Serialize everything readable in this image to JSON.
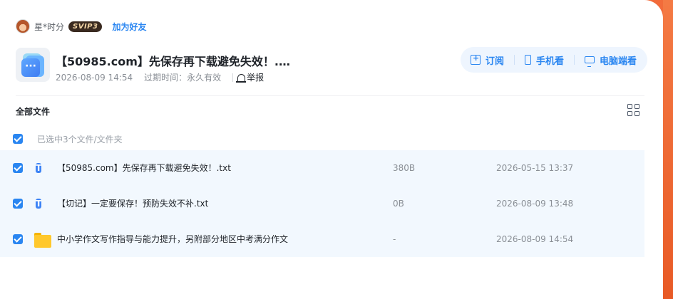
{
  "user": {
    "name": "星*时分",
    "badge": "SVIP3",
    "add_friend": "加为好友"
  },
  "share": {
    "title": "【50985.com】先保存再下载避免失效！.…",
    "date": "2026-08-09 14:54",
    "expire": "过期时间：永久有效",
    "report": "举报"
  },
  "actions": {
    "subscribe": "订阅",
    "mobile": "手机看",
    "desktop": "电脑端看"
  },
  "list": {
    "header": "全部文件",
    "selected_text": "已选中3个文件/文件夹",
    "files": [
      {
        "name": "【50985.com】先保存再下载避免失效！.txt",
        "size": "380B",
        "date": "2026-05-15 13:37",
        "type": "txt",
        "icon": "T"
      },
      {
        "name": "【切记】一定要保存！预防失效不补.txt",
        "size": "0B",
        "date": "2026-08-09 13:48",
        "type": "txt",
        "icon": "T"
      },
      {
        "name": "中小学作文写作指导与能力提升，另附部分地区中考满分作文",
        "size": "-",
        "date": "2026-08-09 14:54",
        "type": "folder",
        "icon": ""
      }
    ]
  },
  "colors": {
    "accent": "#2a86f1",
    "background": "#f26b3a",
    "row_selected": "#f2f8fe"
  }
}
